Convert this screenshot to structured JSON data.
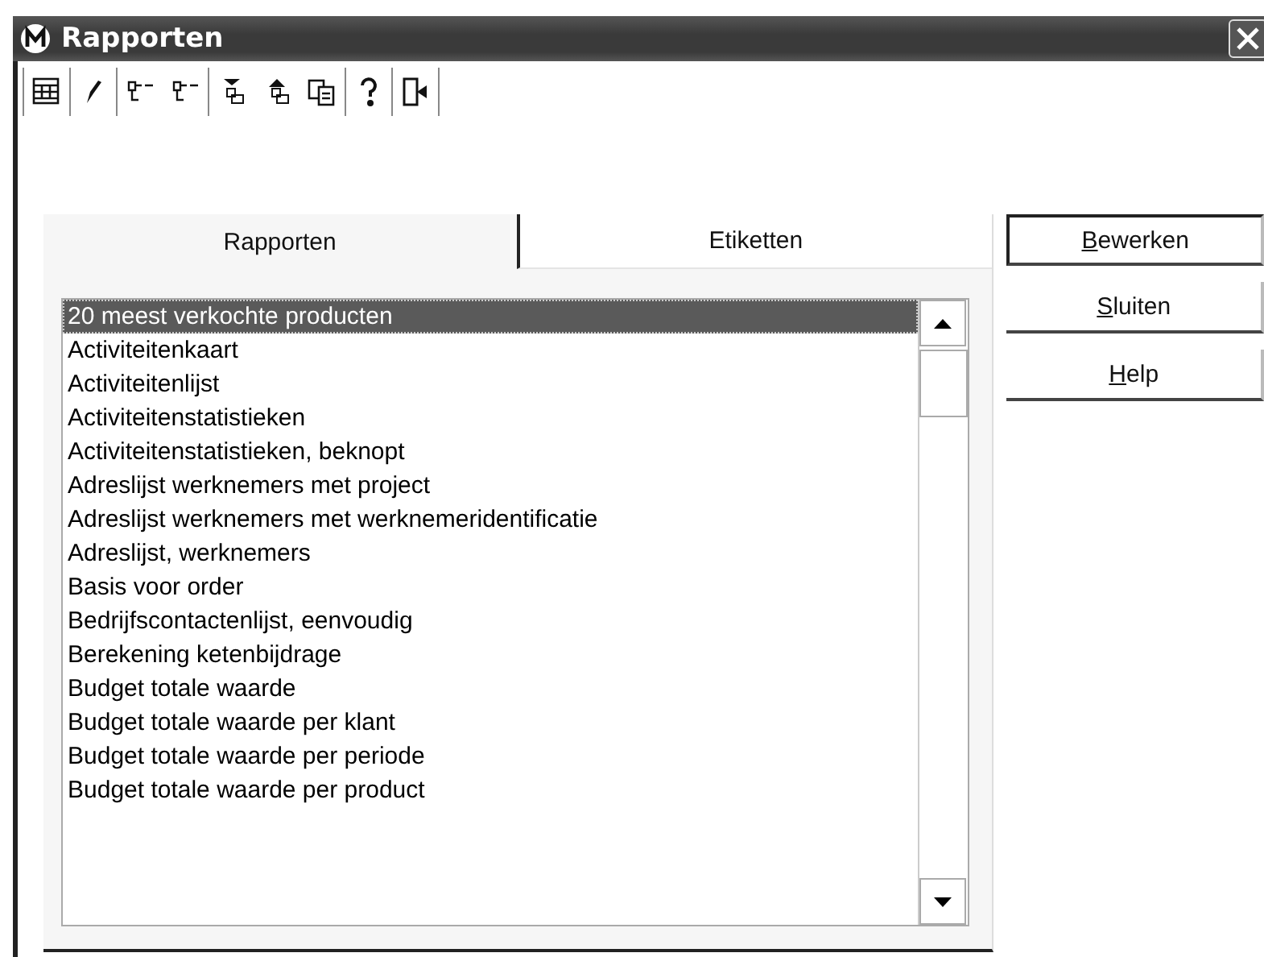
{
  "window": {
    "title": "Rapporten"
  },
  "tabs": [
    {
      "label": "Rapporten",
      "selected": true
    },
    {
      "label": "Etiketten",
      "selected": false
    }
  ],
  "reports": [
    {
      "label": "20 meest verkochte producten",
      "selected": true
    },
    {
      "label": "Activiteitenkaart",
      "selected": false
    },
    {
      "label": "Activiteitenlijst",
      "selected": false
    },
    {
      "label": "Activiteitenstatistieken",
      "selected": false
    },
    {
      "label": "Activiteitenstatistieken, beknopt",
      "selected": false
    },
    {
      "label": "Adreslijst werknemers met project",
      "selected": false
    },
    {
      "label": "Adreslijst werknemers met werknemeridentificatie",
      "selected": false
    },
    {
      "label": "Adreslijst, werknemers",
      "selected": false
    },
    {
      "label": "Basis voor order",
      "selected": false
    },
    {
      "label": "Bedrijfscontactenlijst, eenvoudig",
      "selected": false
    },
    {
      "label": "Berekening ketenbijdrage",
      "selected": false
    },
    {
      "label": "Budget totale waarde",
      "selected": false
    },
    {
      "label": "Budget totale waarde per klant",
      "selected": false
    },
    {
      "label": "Budget totale waarde per periode",
      "selected": false
    },
    {
      "label": "Budget totale waarde per product",
      "selected": false
    }
  ],
  "buttons": [
    {
      "accelerator": "B",
      "rest": "ewerken",
      "default": true
    },
    {
      "accelerator": "S",
      "rest": "luiten",
      "default": false
    },
    {
      "accelerator": "H",
      "rest": "elp",
      "default": false
    }
  ]
}
